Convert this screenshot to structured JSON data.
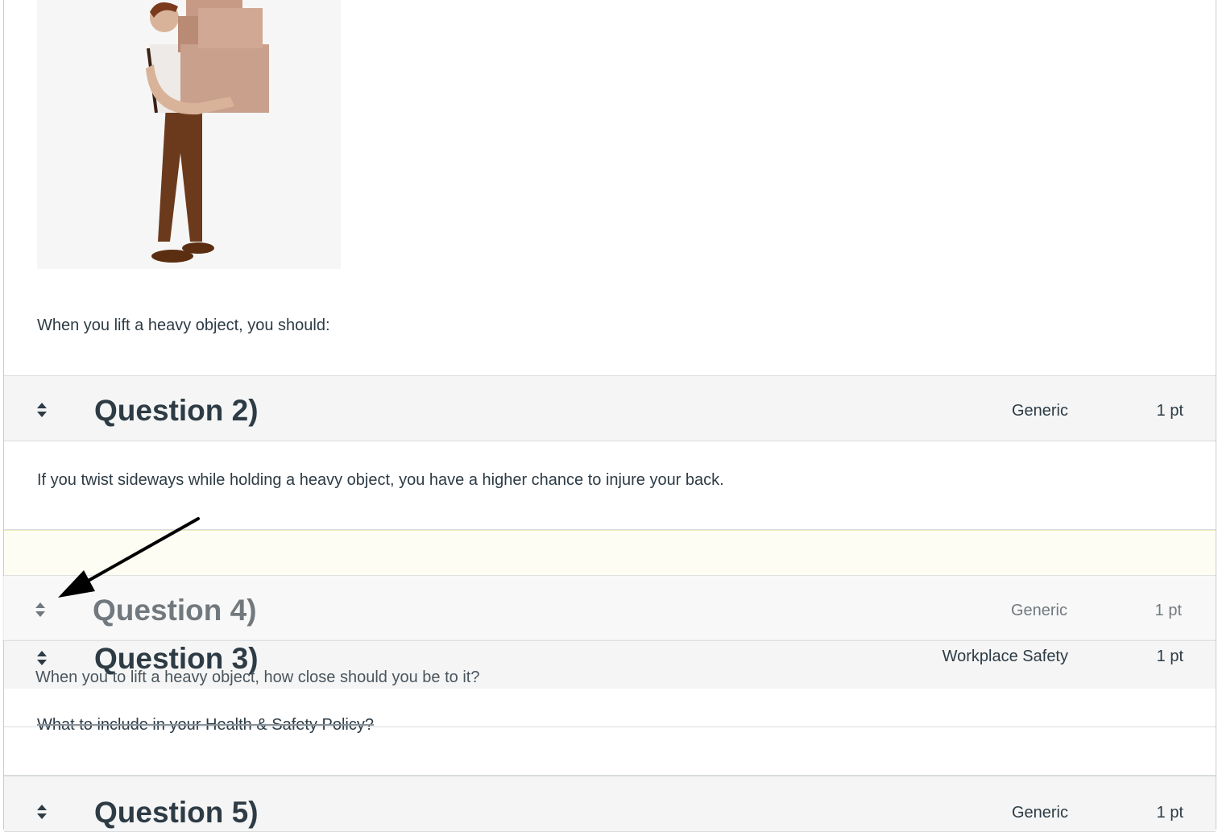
{
  "question1": {
    "text": "When you lift a heavy object, you should:"
  },
  "question2": {
    "title": "Question 2)",
    "bank": "Generic",
    "points": "1 pt",
    "text": "If you twist sideways while holding a heavy object, you have a higher chance to injure your back."
  },
  "question4": {
    "title": "Question 4)",
    "bank": "Generic",
    "points": "1 pt",
    "text": "When you to lift a heavy object, how close should you be to it?"
  },
  "question3": {
    "title": "Question 3)",
    "bank": "Workplace Safety",
    "points": "1 pt",
    "text": "What to include in your Health & Safety Policy?"
  },
  "question5": {
    "title": "Question 5)",
    "bank": "Generic",
    "points": "1 pt"
  },
  "icons": {
    "drag_handle": "sort-arrows-icon",
    "pointer": "arrow-pointer-icon"
  },
  "colors": {
    "header_bg": "#f5f5f5",
    "text": "#2d3b45",
    "placeholder_bg": "#fdfdf3"
  }
}
